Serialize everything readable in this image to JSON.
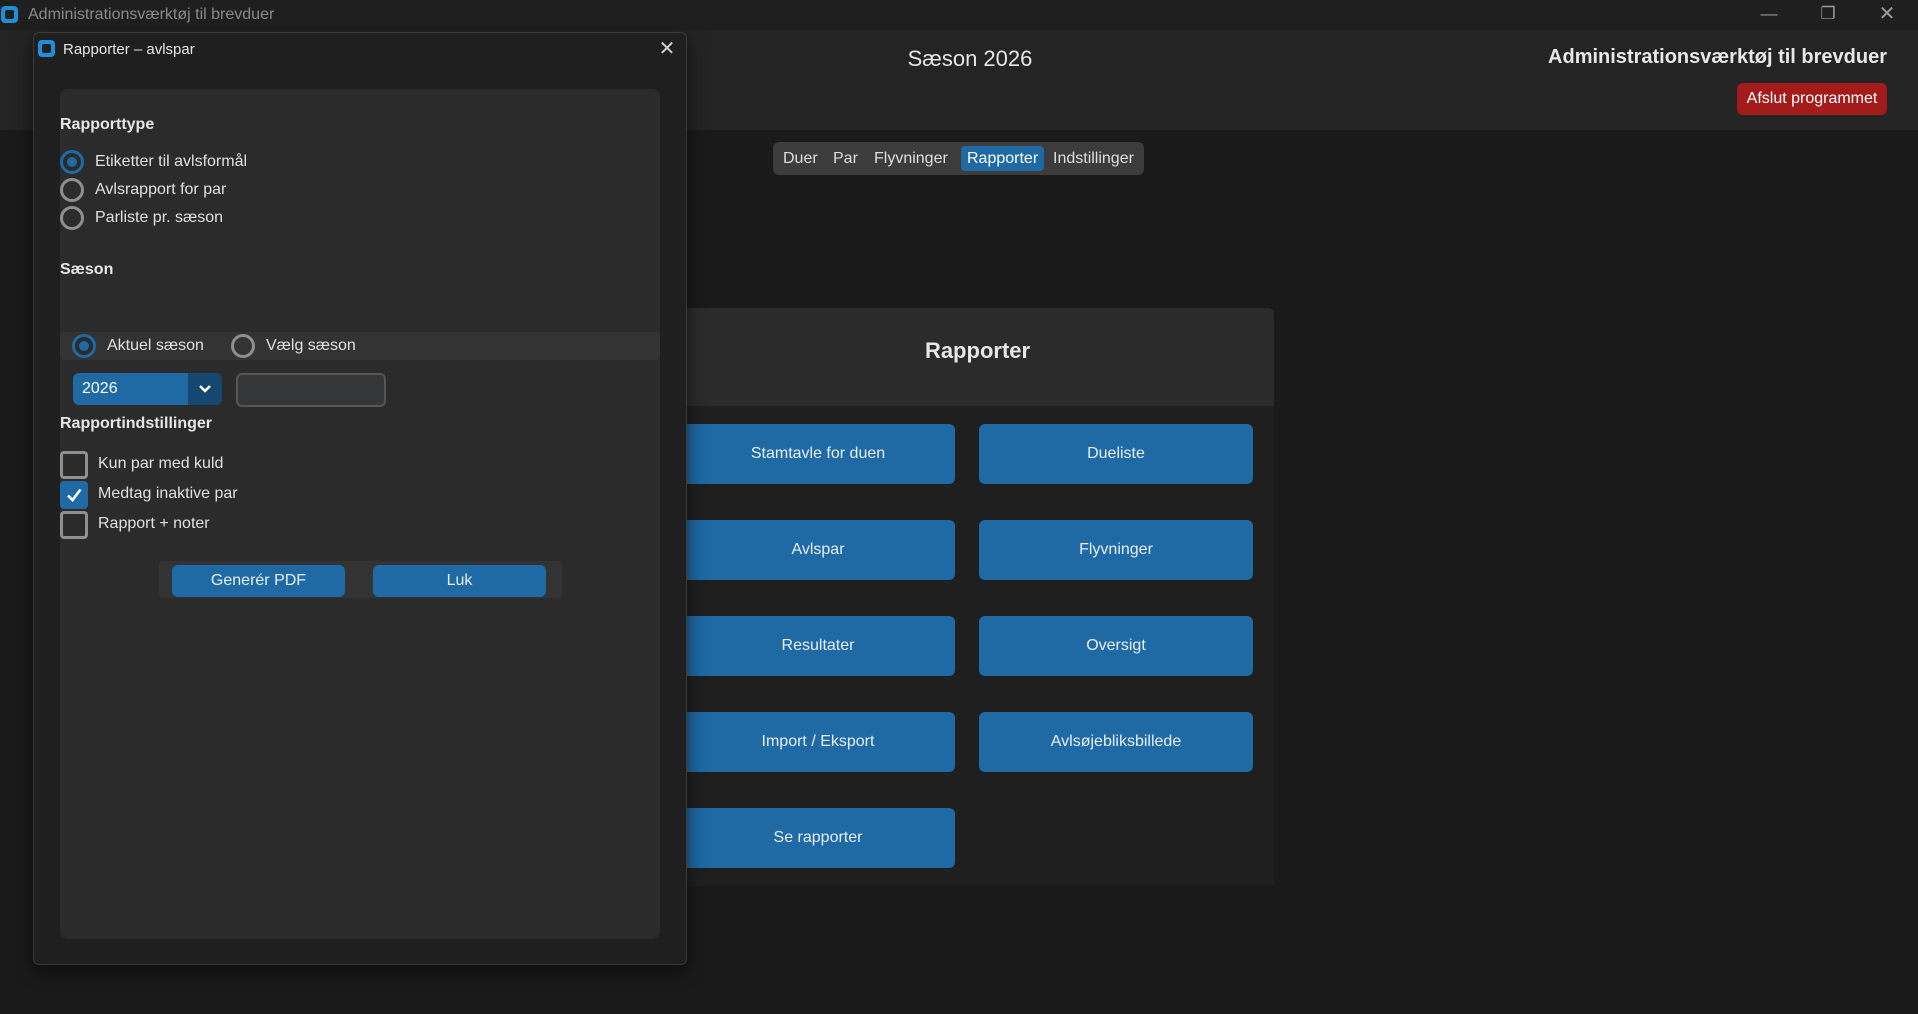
{
  "window": {
    "title": "Administrationsværktøj til brevduer",
    "icon": "app-icon",
    "controls": {
      "minimize": "—",
      "maximize": "❐",
      "close": "✕"
    }
  },
  "header": {
    "season_title": "Sæson 2026",
    "app_title": "Administrationsværktøj til brevduer",
    "quit_label": "Afslut programmet"
  },
  "nav": {
    "items": [
      {
        "label": "Duer",
        "active": false
      },
      {
        "label": "Par",
        "active": false
      },
      {
        "label": "Flyvninger",
        "active": false
      },
      {
        "label": "Rapporter",
        "active": true
      },
      {
        "label": "Indstillinger",
        "active": false
      }
    ]
  },
  "reports": {
    "title": "Rapporter",
    "buttons": [
      "Stamtavle for duen",
      "Dueliste",
      "Avlspar",
      "Flyvninger",
      "Resultater",
      "Oversigt",
      "Import / Eksport",
      "Avlsøjebliksbillede",
      "Se rapporter"
    ]
  },
  "dialog": {
    "title": "Rapporter – avlspar",
    "close": "✕",
    "report_type": {
      "label": "Rapporttype",
      "options": [
        {
          "label": "Etiketter til avlsformål",
          "checked": true
        },
        {
          "label": "Avlsrapport for par",
          "checked": false
        },
        {
          "label": "Parliste pr. sæson",
          "checked": false
        }
      ]
    },
    "season": {
      "label": "Sæson",
      "options": [
        {
          "label": "Aktuel sæson",
          "checked": true
        },
        {
          "label": "Vælg sæson",
          "checked": false
        }
      ],
      "selected": "2026",
      "input_value": ""
    },
    "settings": {
      "label": "Rapportindstillinger",
      "options": [
        {
          "label": "Kun par med kuld",
          "checked": false
        },
        {
          "label": "Medtag inaktive par",
          "checked": true
        },
        {
          "label": "Rapport + noter",
          "checked": false
        }
      ]
    },
    "buttons": {
      "generate": "Generér PDF",
      "close": "Luk"
    }
  },
  "colors": {
    "accent": "#1f6aa5",
    "danger": "#a31b1b",
    "background": "#1a1a1a",
    "panel": "#2b2b2b"
  }
}
